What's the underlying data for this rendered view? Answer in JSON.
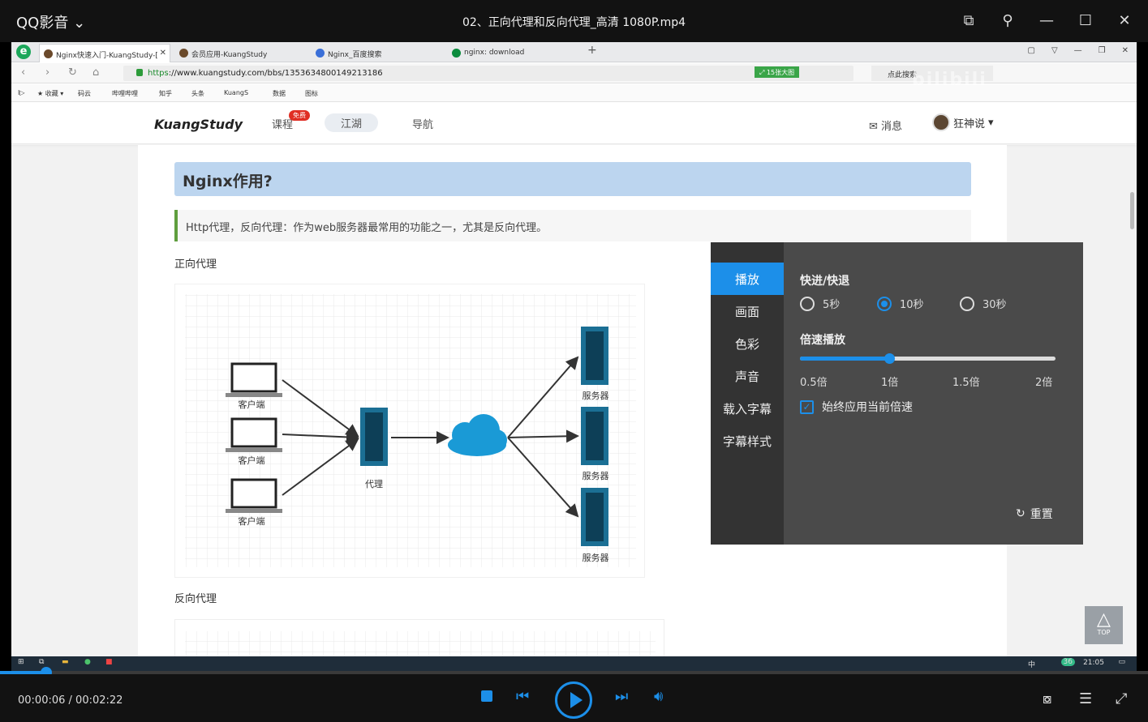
{
  "player": {
    "app_title": "QQ影音",
    "video_title": "02、正向代理和反向代理_高清 1080P.mp4",
    "time_current": "00:00:06",
    "time_total": "00:02:22",
    "progress_fraction": 0.04,
    "accent_color": "#1c8fe9"
  },
  "browser": {
    "tabs": [
      {
        "label": "Nginx快速入门-KuangStudy-[",
        "active": true
      },
      {
        "label": "会员应用-KuangStudy",
        "active": false
      },
      {
        "label": "Nginx_百度搜索",
        "active": false
      },
      {
        "label": "nginx: download",
        "active": false
      }
    ],
    "url_scheme": "https",
    "url_rest": "://www.kuangstudy.com/bbs/1353634800149213186",
    "url_badge": "15张大图",
    "search_placeholder": "点此搜索",
    "bookmarks": [
      "收藏",
      "码云",
      "哔哩哔哩",
      "知乎",
      "头条",
      "KuangS",
      "数据",
      "图标"
    ],
    "watermark": "bilibili"
  },
  "site": {
    "logo": "KuangStudy",
    "nav": [
      {
        "label": "课程",
        "badge": "免费"
      },
      {
        "label": "江湖",
        "active": true
      },
      {
        "label": "导航"
      }
    ],
    "messages_label": "消息",
    "user_name": "狂神说"
  },
  "article": {
    "heading": "Nginx作用?",
    "quote": "Http代理，反向代理：作为web服务器最常用的功能之一，尤其是反向代理。",
    "section1": "正向代理",
    "section2": "反向代理",
    "diagram": {
      "client_label": "客户端",
      "proxy_label": "代理",
      "server_label": "服务器"
    },
    "totop_label": "TOP"
  },
  "settings": {
    "menu": [
      "播放",
      "画面",
      "色彩",
      "声音",
      "载入字幕",
      "字幕样式"
    ],
    "active_menu": "播放",
    "seek_title": "快进/快退",
    "seek_options": [
      "5秒",
      "10秒",
      "30秒"
    ],
    "seek_selected": "10秒",
    "speed_title": "倍速播放",
    "speed_ticks": [
      "0.5倍",
      "1倍",
      "1.5倍",
      "2倍"
    ],
    "speed_value": "1倍",
    "speed_fraction": 0.348,
    "always_apply_label": "始终应用当前倍速",
    "always_apply_checked": true,
    "reset_label": "重置"
  },
  "taskbar": {
    "clock": "21:05",
    "ime": "中",
    "badge": "36"
  }
}
